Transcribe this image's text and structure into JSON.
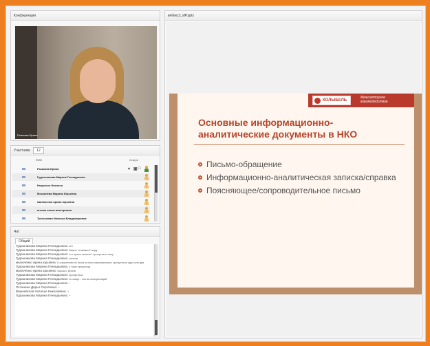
{
  "conference": {
    "title": "Конференция",
    "video_name": "Рыжкова Ирина"
  },
  "participants": {
    "title": "Участники",
    "count": "12",
    "col_name": "ФИО",
    "col_status": "Статус",
    "rows": [
      "Рыжкова Ирина",
      "Гудошникова Марина Геннадьевна",
      "Недолько Наталья",
      "Москалева Марина Юрьевна",
      "малюченко ирина юрьевна",
      "агеева елена викторовна",
      "Третьякова Наталья Владимировна"
    ]
  },
  "chat": {
    "title": "Чат",
    "tab": "Общий",
    "messages": [
      {
        "who": "Гудошникова Марина Геннадьевна:",
        "text": "нет"
      },
      {
        "who": "Гудошникова Марина Геннадьевна:",
        "text": "Важно \"отжимать\" виду"
      },
      {
        "who": "Гудошникова Марина Геннадьевна:",
        "text": "что нужно сказать? пропустила тему"
      },
      {
        "who": "Гудошникова Марина Геннадьевна:",
        "text": "понила"
      },
      {
        "who": "малюченко ирина юрьевна:",
        "text": "К сожалению не была на всех мероприятиях, пропустила одно или два"
      },
      {
        "who": "Гудошникова Марина Геннадьевна:",
        "text": "я тоже пропустид"
      },
      {
        "who": "малюченко ирина юрьевна:",
        "text": "хорошо, Ирина"
      },
      {
        "who": "Гудошникова Марина Геннадьевна:",
        "text": "пропустила"
      },
      {
        "who": "Гудошникова Марина Геннадьевна:",
        "text": "по смарт - кол-во консультаций"
      },
      {
        "who": "Гудошникова Марина Геннадьевна:",
        "text": "+"
      },
      {
        "who": "Останина Дарья Сергеевна:",
        "text": "+"
      },
      {
        "who": "Вишневская Наталья Николаевна:",
        "text": "+"
      },
      {
        "who": "Гудошникова Марина Геннадьевна:",
        "text": "+"
      }
    ]
  },
  "presentation": {
    "title": "вебекс3_ИР.pptx",
    "logo_name": "КОЛЫБЕЛЬ",
    "logo_tagline_1": "Межсекторное",
    "logo_tagline_2": "взаимодействие",
    "slide_title": "Основные информационно-аналитические документы в НКО",
    "bullets": [
      "Письмо-обращение",
      "Информационно-аналитическая записка/справка",
      "Поясняющее/сопроводительное письмо"
    ]
  },
  "colors": {
    "accent_orange": "#ee7f1e",
    "slide_accent": "#b5452b",
    "logo_red": "#b93a2c"
  }
}
